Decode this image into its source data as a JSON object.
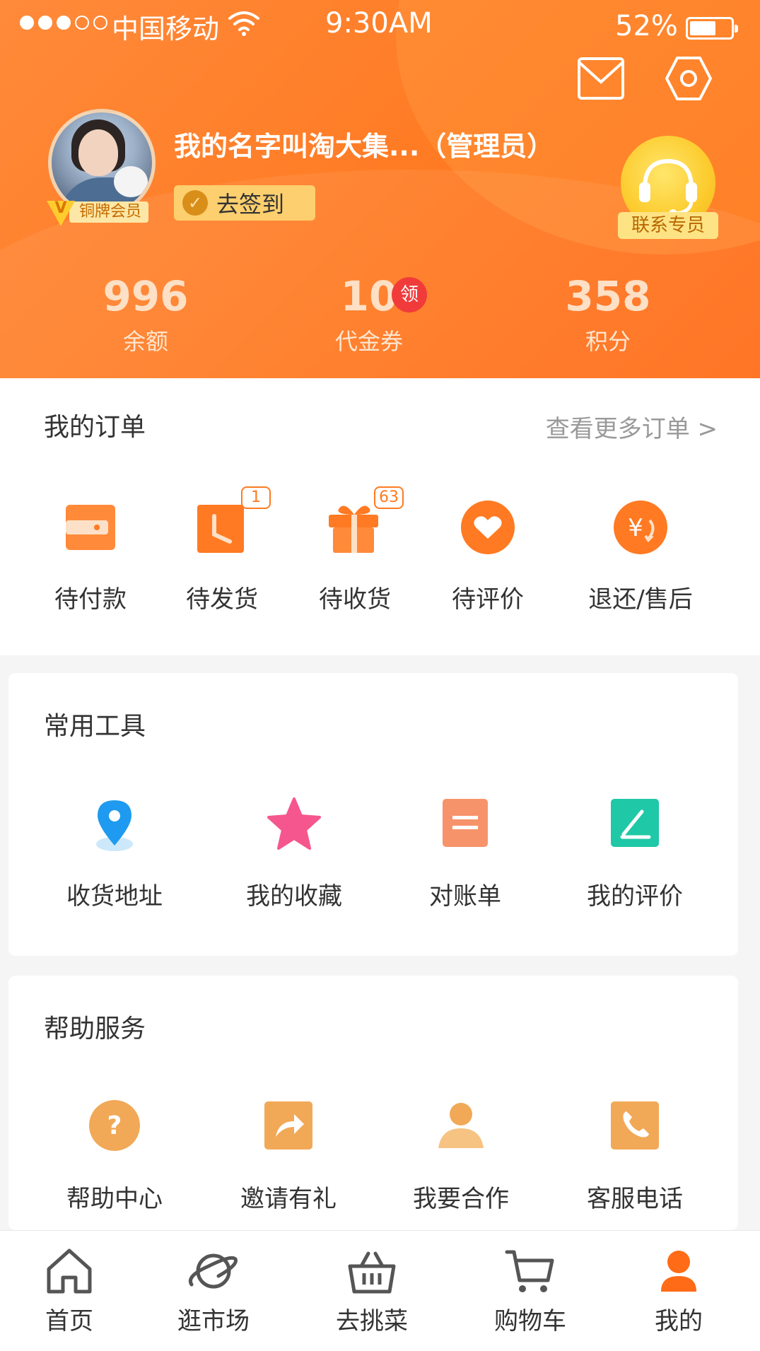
{
  "status_bar": {
    "carrier": "中国移动",
    "time": "9:30AM",
    "battery": "52%"
  },
  "profile": {
    "username": "我的名字叫淘大集...（管理员）",
    "member_level": "铜牌会员",
    "checkin_label": "去签到",
    "service_label": "联系专员"
  },
  "stats": {
    "balance": {
      "value": "996",
      "label": "余额"
    },
    "voucher": {
      "value": "10",
      "label": "代金券",
      "tag": "领"
    },
    "points": {
      "value": "358",
      "label": "积分"
    }
  },
  "orders": {
    "title": "我的订单",
    "more": "查看更多订单 >",
    "items": [
      {
        "label": "待付款",
        "icon": "wallet-icon"
      },
      {
        "label": "待发货",
        "icon": "clock-icon",
        "badge": "1"
      },
      {
        "label": "待收货",
        "icon": "gift-icon",
        "badge": "63"
      },
      {
        "label": "待评价",
        "icon": "heart-icon"
      },
      {
        "label": "退还/售后",
        "icon": "refund-icon"
      }
    ]
  },
  "tools": {
    "title": "常用工具",
    "items": [
      {
        "label": "收货地址",
        "icon": "location-pin-icon"
      },
      {
        "label": "我的收藏",
        "icon": "star-icon"
      },
      {
        "label": "对账单",
        "icon": "statement-icon"
      },
      {
        "label": "我的评价",
        "icon": "edit-icon"
      }
    ]
  },
  "help": {
    "title": "帮助服务",
    "items": [
      {
        "label": "帮助中心",
        "icon": "question-icon"
      },
      {
        "label": "邀请有礼",
        "icon": "share-icon"
      },
      {
        "label": "我要合作",
        "icon": "person-icon"
      },
      {
        "label": "客服电话",
        "icon": "phone-icon"
      }
    ]
  },
  "tabbar": {
    "items": [
      {
        "label": "首页",
        "icon": "home-icon"
      },
      {
        "label": "逛市场",
        "icon": "planet-icon"
      },
      {
        "label": "去挑菜",
        "icon": "basket-icon"
      },
      {
        "label": "购物车",
        "icon": "cart-icon"
      },
      {
        "label": "我的",
        "icon": "user-icon",
        "active": true
      }
    ]
  },
  "colors": {
    "accent": "#ff7a22",
    "badge_red": "#f13b3b",
    "tools_pin": "#1e9bf0",
    "tools_star": "#f5568d",
    "tools_statement": "#f7936a",
    "tools_review": "#1fc8a6",
    "help_icon": "#f1a957"
  }
}
